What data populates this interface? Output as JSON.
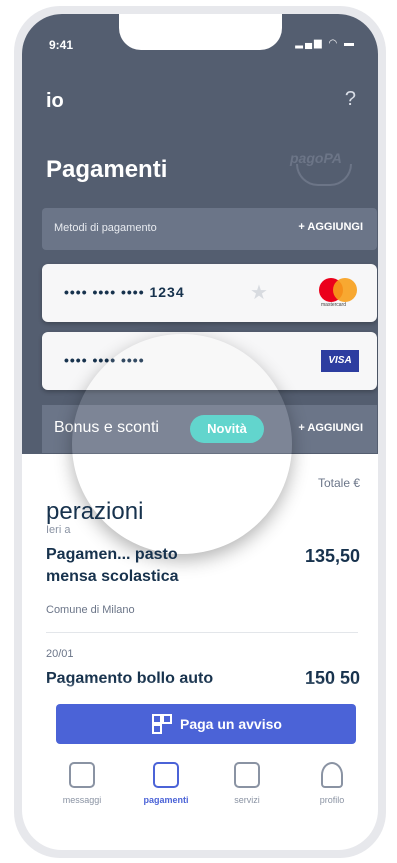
{
  "status_bar": {
    "time": "9:41"
  },
  "header": {
    "logo": "io",
    "help": "?",
    "title": "Pagamenti",
    "brand_logo": "pagoPA"
  },
  "payment_methods": {
    "label": "Metodi di pagamento",
    "add": "+ AGGIUNGI"
  },
  "cards": [
    {
      "number": "•••• •••• •••• 1234",
      "brand": "mastercard",
      "favorite": false
    },
    {
      "number": "•••• •••• ••••",
      "brand": "VISA"
    }
  ],
  "bonus": {
    "label": "Bonus e sconti",
    "badge": "Novità",
    "add": "+ AGGIUNGI"
  },
  "operations": {
    "title": "perazioni",
    "total_label": "Totale €",
    "section_label": "Ieri a",
    "items": [
      {
        "title": "Pagamen... pasto mensa scolastica",
        "amount": "135,50",
        "subtitle": "Comune di Milano"
      },
      {
        "date": "20/01",
        "title": "Pagamento bollo auto",
        "amount": "150 50"
      }
    ]
  },
  "cta": {
    "label": "Paga un avviso"
  },
  "tabs": [
    {
      "label": "messaggi",
      "icon": "chat-icon",
      "active": false
    },
    {
      "label": "pagamenti",
      "icon": "wallet-icon",
      "active": true
    },
    {
      "label": "servizi",
      "icon": "services-icon",
      "active": false
    },
    {
      "label": "profilo",
      "icon": "person-icon",
      "active": false
    }
  ],
  "colors": {
    "header_bg": "#545e70",
    "accent": "#4b63d7",
    "badge": "#4dd0c6",
    "text_dark": "#17324d"
  }
}
